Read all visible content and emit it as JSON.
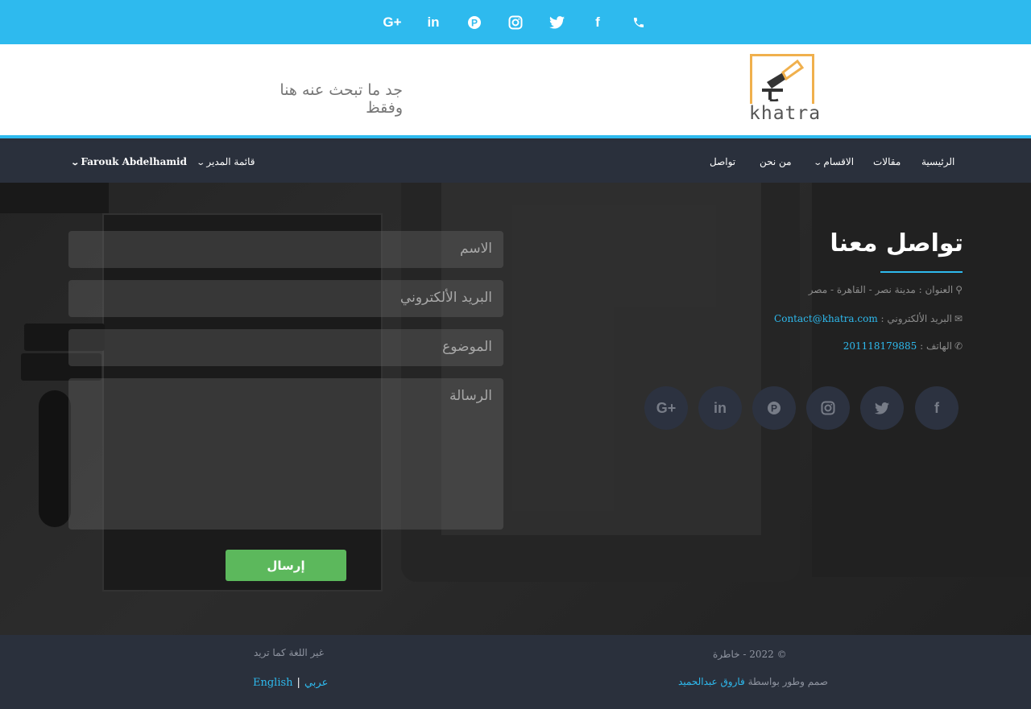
{
  "topbar": {
    "icons": [
      "google-plus-icon",
      "linkedin-icon",
      "pinterest-icon",
      "instagram-icon",
      "twitter-icon",
      "facebook-icon",
      "phone-icon"
    ],
    "glyphs": [
      "G+",
      "in",
      "P",
      "◎",
      "🐦",
      "f",
      "✆"
    ]
  },
  "header": {
    "tagline": "جد ما تبحث عنه هنا وفقظ",
    "logo_text": "khatra",
    "accent": "#2ebaee",
    "logo_color": "#f0b04d"
  },
  "nav": {
    "home": "الرئيسية",
    "articles": "مقالات",
    "sections": "الاقسام",
    "about": "من نحن",
    "contact": "تواصل",
    "admin_menu": "قائمة المدير",
    "user": "Farouk Abdelhamid"
  },
  "form": {
    "name_placeholder": "الاسم",
    "email_placeholder": "البريد الألكتروني",
    "subject_placeholder": "الموضوع",
    "message_placeholder": "الرسالة",
    "submit": "إرسال",
    "submit_color": "#5cb85c"
  },
  "contact": {
    "title": "تواصل معنا",
    "address": "العنوان : مدينة نصر - القاهرة - مصر",
    "email_label": "البريد الألكتروني :",
    "email": "Contact@khatra.com",
    "phone_label": "الهاتف :",
    "phone": "201118179885",
    "social": [
      {
        "icon": "google-plus-icon",
        "glyph": "G+"
      },
      {
        "icon": "linkedin-icon",
        "glyph": "in"
      },
      {
        "icon": "pinterest-icon",
        "glyph": "P"
      },
      {
        "icon": "instagram-icon",
        "glyph": "◎"
      },
      {
        "icon": "twitter-icon",
        "glyph": "🐦"
      },
      {
        "icon": "facebook-icon",
        "glyph": "f"
      }
    ]
  },
  "footer": {
    "copyright": "© 2022 - خاطرة",
    "designed_by": "صمم وطور بواسطة",
    "author": "فاروق عبدالحميد",
    "change_lang": "غير اللغة كما تريد",
    "lang_ar": "عربي",
    "lang_en": "English"
  }
}
